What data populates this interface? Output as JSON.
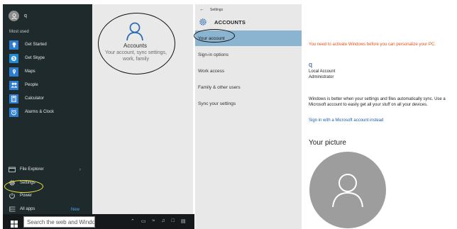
{
  "start_menu": {
    "user_name": "q",
    "most_used_header": "Most used",
    "apps": [
      {
        "label": "Get Started",
        "icon": "lightbulb-icon",
        "color": "#2d7dd2"
      },
      {
        "label": "Get Skype",
        "icon": "skype-icon",
        "color": "#1f8bd6"
      },
      {
        "label": "Maps",
        "icon": "maps-icon",
        "color": "#2d7dd2"
      },
      {
        "label": "People",
        "icon": "people-icon",
        "color": "#2d7dd2"
      },
      {
        "label": "Calculator",
        "icon": "calculator-icon",
        "color": "#2d7dd2"
      },
      {
        "label": "Alarms & Clock",
        "icon": "alarm-clock-icon",
        "color": "#2d7dd2"
      }
    ],
    "file_explorer": "File Explorer",
    "settings": "Settings",
    "power": "Power",
    "all_apps": "All apps",
    "new_badge": "New"
  },
  "taskbar": {
    "search_placeholder": "Search the web and Windows"
  },
  "settings_tile": {
    "title": "Accounts",
    "description": "Your account, sync settings, work, family"
  },
  "settings_window": {
    "back_label": "Settings",
    "header": "ACCOUNTS",
    "nav": [
      "Your account",
      "Sign-in options",
      "Work access",
      "Family & other users",
      "Sync your settings"
    ],
    "activation_warning": "You need to activate Windows before you can personalize your PC.",
    "account_name": "q",
    "account_type": "Local Account",
    "account_role": "Administrator",
    "sync_paragraph": "Windows is better when your settings and files automatically sync. Use a Microsoft account to easily get all your stuff on all your devices.",
    "msa_link": "Sign in with a Microsoft account instead",
    "picture_heading": "Your picture"
  },
  "colors": {
    "accent_blue": "#1a5ea8",
    "warning_orange": "#e8501a",
    "nav_selected": "#8ab4cf",
    "highlight_yellow": "#e8e23a"
  }
}
